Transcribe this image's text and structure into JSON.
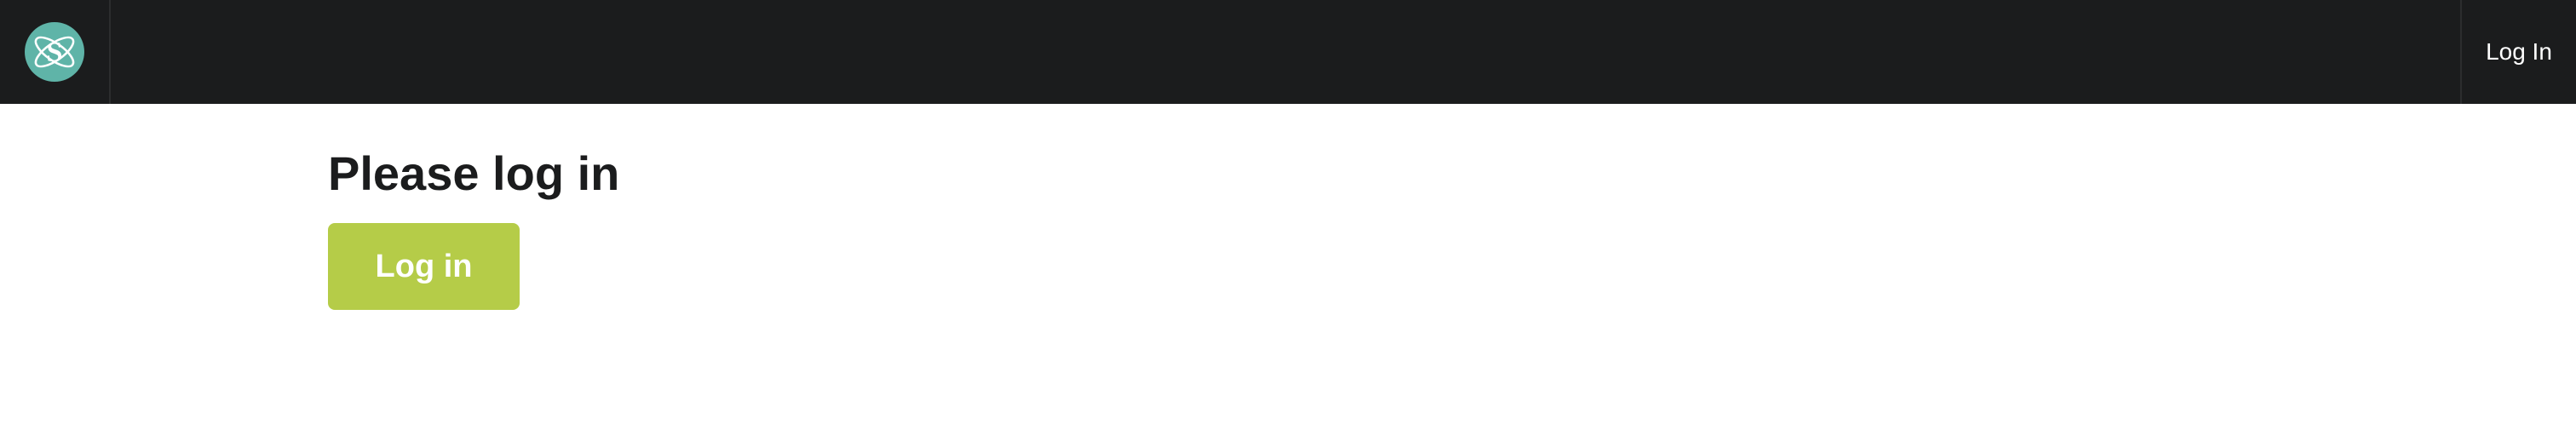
{
  "app": {
    "logo_icon": "atom-s-logo-icon",
    "logo_letter": "S"
  },
  "header": {
    "login_label": "Log In"
  },
  "main": {
    "title": "Please log in",
    "login_button_label": "Log in"
  },
  "colors": {
    "topbar_background": "#1b1c1d",
    "logo_background": "#5fb4a8",
    "button_background": "#b5cc48",
    "title_text": "#1b1c1d"
  }
}
